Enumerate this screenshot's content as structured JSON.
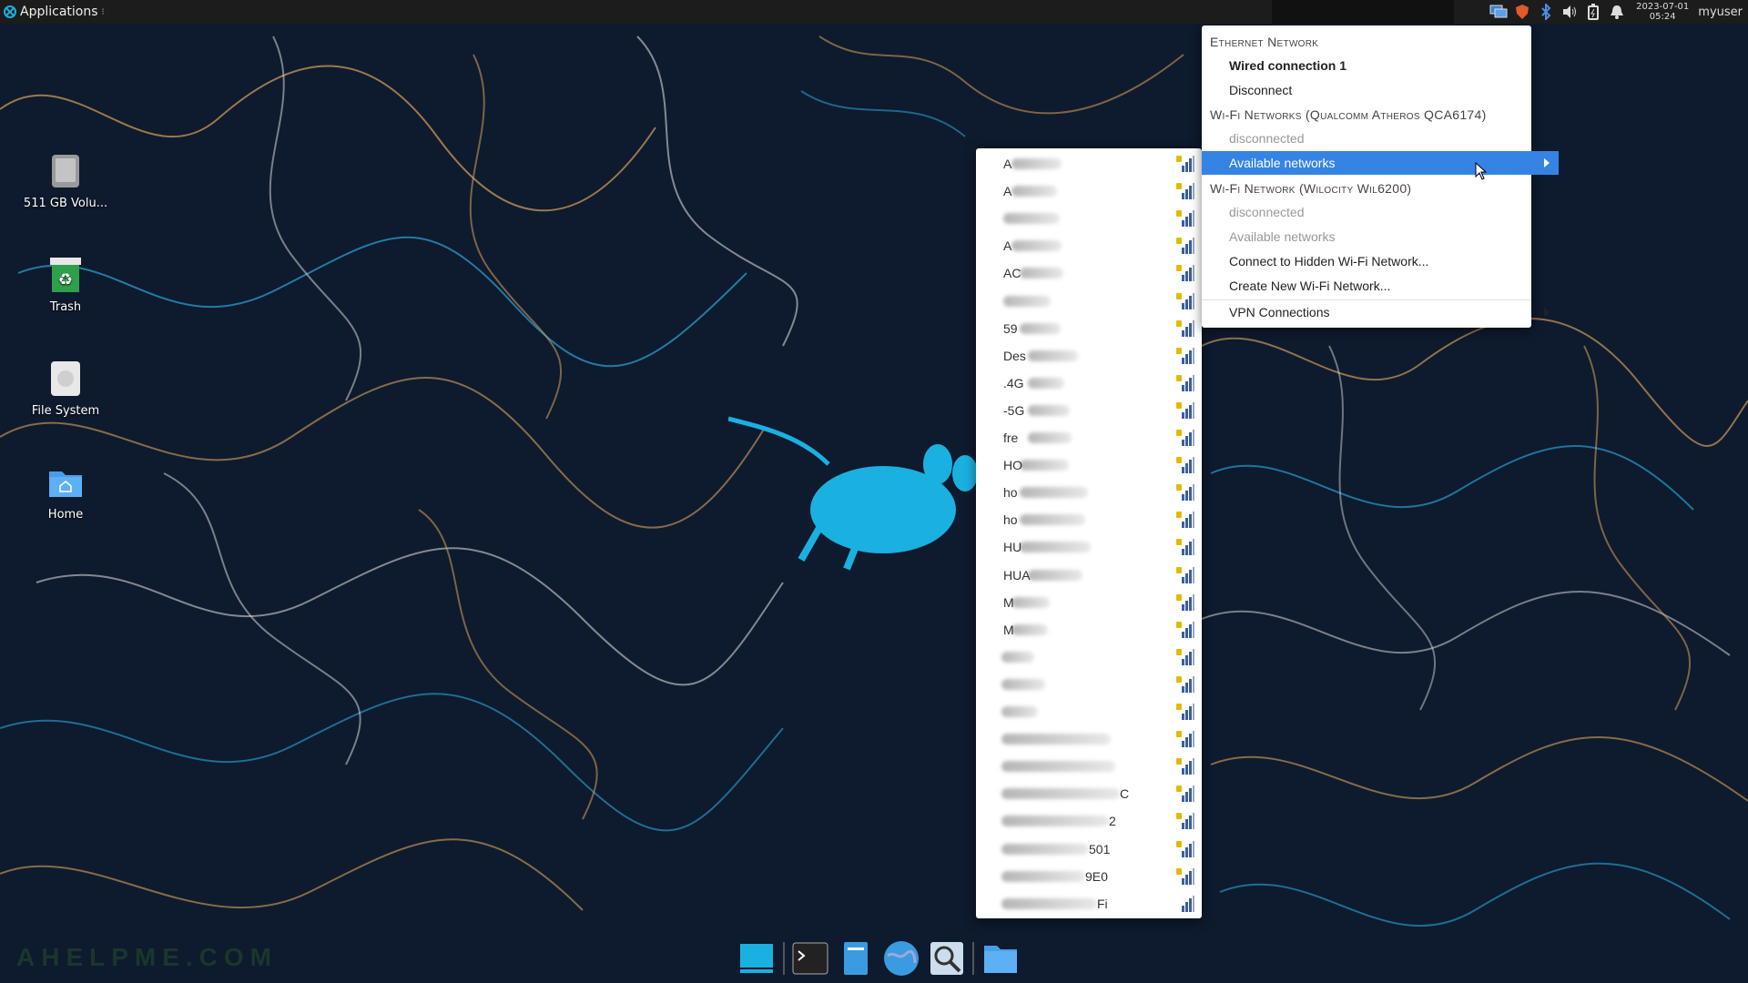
{
  "panel": {
    "apps_label": "Applications",
    "clock_date": "2023-07-01",
    "clock_time": "05:24",
    "username": "myuser"
  },
  "desktop": {
    "icons": [
      {
        "label": "511 GB Volu..."
      },
      {
        "label": "Trash"
      },
      {
        "label": "File System"
      },
      {
        "label": "Home"
      }
    ]
  },
  "watermark": "AHELPME.COM",
  "nm_menu": {
    "ethernet_header": "Ethernet Network",
    "wired_connection": "Wired connection 1",
    "disconnect": "Disconnect",
    "wifi_qca_header": "Wi-Fi Networks (Qualcomm Atheros QCA6174)",
    "wifi_qca_status": "disconnected",
    "available_networks": "Available networks",
    "wifi_wil_header": "Wi-Fi Network (Wilocity Wil6200)",
    "wifi_wil_status": "disconnected",
    "wifi_wil_available": "Available networks",
    "connect_hidden": "Connect to Hidden Wi-Fi Network...",
    "create_new": "Create New Wi-Fi Network...",
    "vpn": "VPN Connections"
  },
  "networks": [
    {
      "visible": "A",
      "secured": true
    },
    {
      "visible": "A",
      "secured": true
    },
    {
      "visible": "",
      "secured": true
    },
    {
      "visible": "A",
      "secured": true
    },
    {
      "visible": "AC",
      "secured": true
    },
    {
      "visible": "",
      "secured": true
    },
    {
      "visible": "59",
      "secured": true
    },
    {
      "visible": "Des",
      "secured": true
    },
    {
      "visible": ".4G",
      "secured": true
    },
    {
      "visible": "-5G",
      "secured": true
    },
    {
      "visible": "fre",
      "secured": true
    },
    {
      "visible": "HO",
      "secured": true
    },
    {
      "visible": "ho",
      "secured": true
    },
    {
      "visible": "ho",
      "secured": true
    },
    {
      "visible": "HU",
      "secured": true
    },
    {
      "visible": "HUA",
      "secured": true
    },
    {
      "visible": "M",
      "secured": true
    },
    {
      "visible": "M",
      "secured": true
    },
    {
      "visible": "",
      "secured": true
    },
    {
      "visible": "",
      "secured": true
    },
    {
      "visible": "",
      "secured": true
    },
    {
      "visible": "",
      "secured": true
    },
    {
      "visible": "",
      "secured": true
    },
    {
      "visible": "C",
      "secured": true
    },
    {
      "visible": "2",
      "secured": true
    },
    {
      "visible": "501",
      "secured": true
    },
    {
      "visible": "9E0",
      "secured": true
    },
    {
      "visible": "Fi",
      "secured": false
    }
  ],
  "colors": {
    "highlight": "#3584e4",
    "wallpaper_bg": "#0e1a2e",
    "xfce_blue": "#1ab0e0"
  }
}
